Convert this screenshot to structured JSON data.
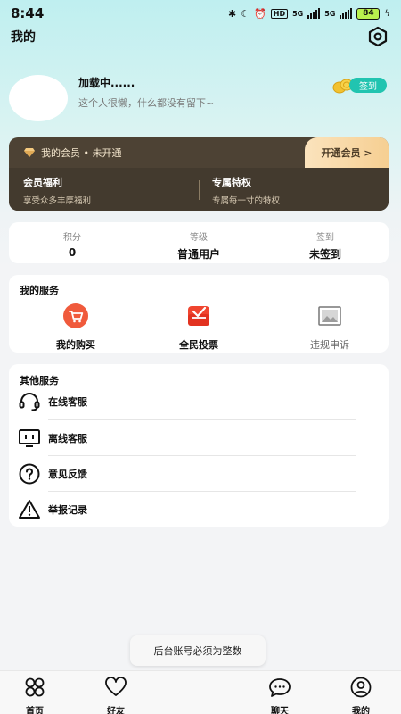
{
  "status_bar": {
    "time": "8:44",
    "network_label_1": "5G",
    "network_label_2": "5G",
    "hd_label": "HD",
    "battery": "84"
  },
  "header": {
    "title": "我的"
  },
  "profile": {
    "username": "加载中......",
    "bio": "这个人很懒，什么都没有留下~",
    "checkin_label": "签到"
  },
  "vip": {
    "status": "我的会员 • 未开通",
    "open_button": "开通会员 >",
    "benefit_title": "会员福利",
    "benefit_desc": "享受众多丰厚福利",
    "privilege_title": "专属特权",
    "privilege_desc": "专属每一寸的特权"
  },
  "stats": [
    {
      "label": "积分",
      "value": "0"
    },
    {
      "label": "等级",
      "value": "普通用户"
    },
    {
      "label": "签到",
      "value": "未签到"
    }
  ],
  "my_services": {
    "title": "我的服务",
    "items": [
      {
        "label": "我的购买",
        "icon": "cart-icon"
      },
      {
        "label": "全民投票",
        "icon": "vote-icon"
      },
      {
        "label": "违规申诉",
        "icon": "image-icon"
      }
    ]
  },
  "other_services": {
    "title": "其他服务",
    "items": [
      {
        "label": "在线客服",
        "icon": "headset-icon"
      },
      {
        "label": "离线客服",
        "icon": "monitor-icon"
      },
      {
        "label": "意见反馈",
        "icon": "question-icon"
      },
      {
        "label": "举报记录",
        "icon": "warning-icon"
      }
    ]
  },
  "toast": "后台账号必须为整数",
  "tabs": [
    {
      "label": "首页",
      "icon": "home-icon"
    },
    {
      "label": "好友",
      "icon": "heart-icon"
    },
    {
      "label": "聊天",
      "icon": "chat-icon"
    },
    {
      "label": "我的",
      "icon": "profile-icon"
    }
  ],
  "colors": {
    "accent": "#21c4b0",
    "vip_bg": "#4d4234",
    "vip_button": "#f6cf92",
    "cart_red": "#f05a3c",
    "vote_red": "#f0452f"
  }
}
